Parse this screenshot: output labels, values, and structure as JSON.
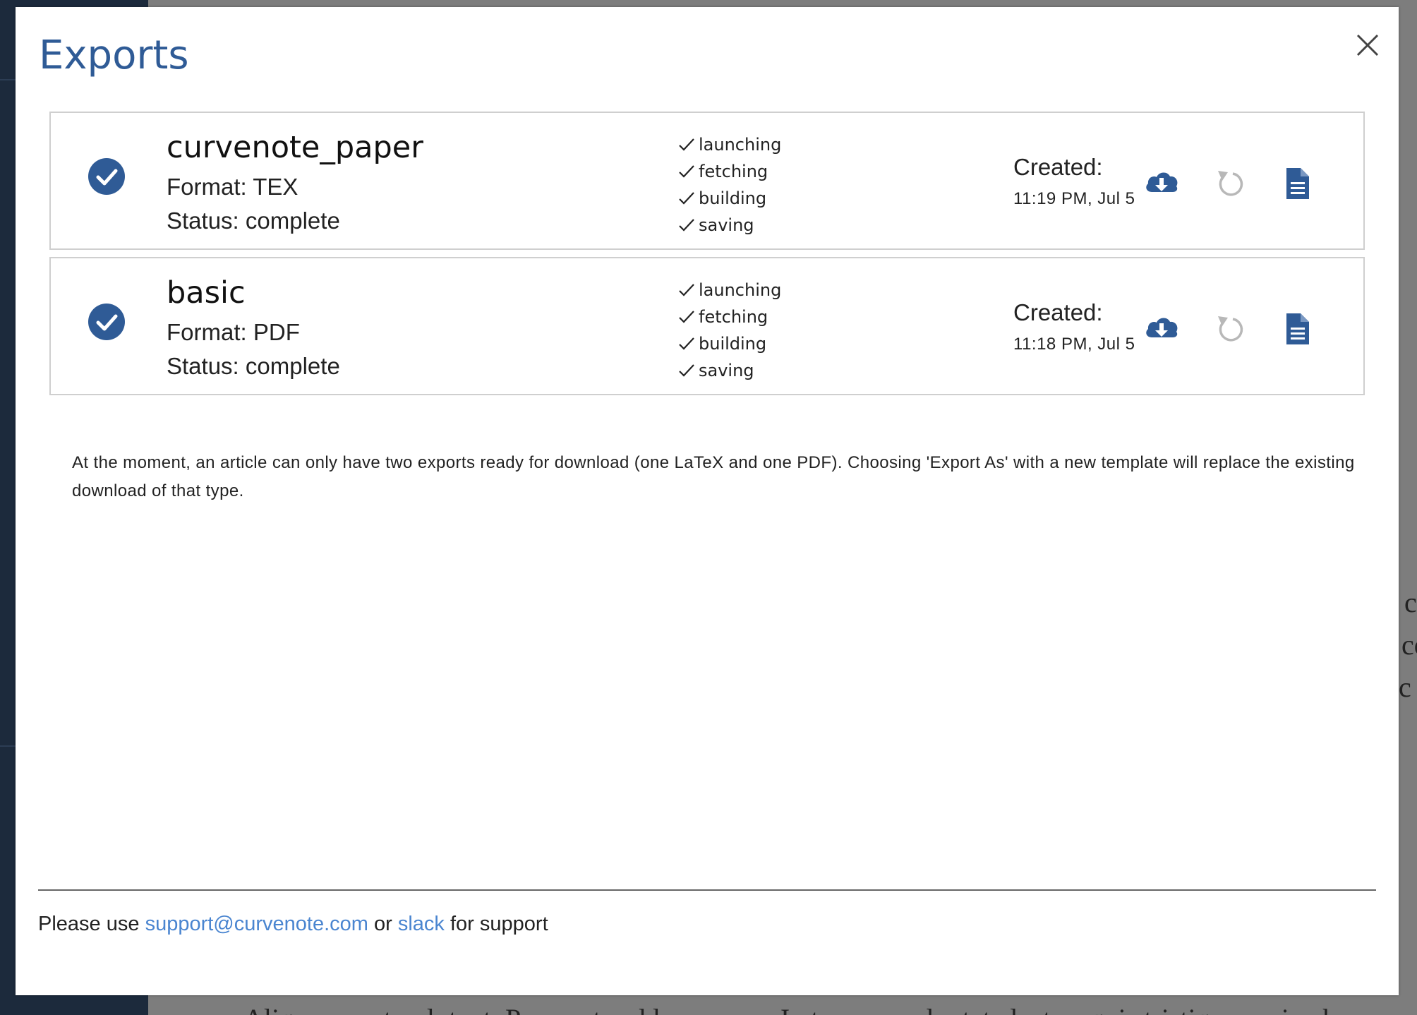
{
  "modal": {
    "title": "Exports",
    "close_icon": "close-icon"
  },
  "exports": [
    {
      "name": "curvenote_paper",
      "format": "Format: TEX",
      "status": "Status: complete",
      "steps": [
        "launching",
        "fetching",
        "building",
        "saving"
      ],
      "created_label": "Created:",
      "created_time": "11:19 PM, Jul 5",
      "icons": [
        "check-circle-icon",
        "cloud-download-icon",
        "retry-icon",
        "document-icon"
      ]
    },
    {
      "name": "basic",
      "format": "Format: PDF",
      "status": "Status: complete",
      "steps": [
        "launching",
        "fetching",
        "building",
        "saving"
      ],
      "created_label": "Created:",
      "created_time": "11:18 PM, Jul 5",
      "icons": [
        "check-circle-icon",
        "cloud-download-icon",
        "retry-icon",
        "document-icon"
      ]
    }
  ],
  "info": "At the moment, an article can only have two exports ready for download (one LaTeX and one PDF). Choosing 'Export As' with a new template will replace the existing download of that type.",
  "footer": {
    "prefix": "Please use",
    "email_link": "support@curvenote.com",
    "middle": "or",
    "slack_link": "slack",
    "suffix": "for support"
  },
  "colors": {
    "accent": "#2f5b96",
    "link": "#4a85d0",
    "disabled_icon": "#b8b8b8"
  },
  "background": {
    "right_text": [
      "c",
      "cc",
      "c v"
    ],
    "bottom_text": "Aliquam erat volutpat. Praesent sed lacus arcu. In tempor vulputate lectus, quis tristique sapien b"
  }
}
